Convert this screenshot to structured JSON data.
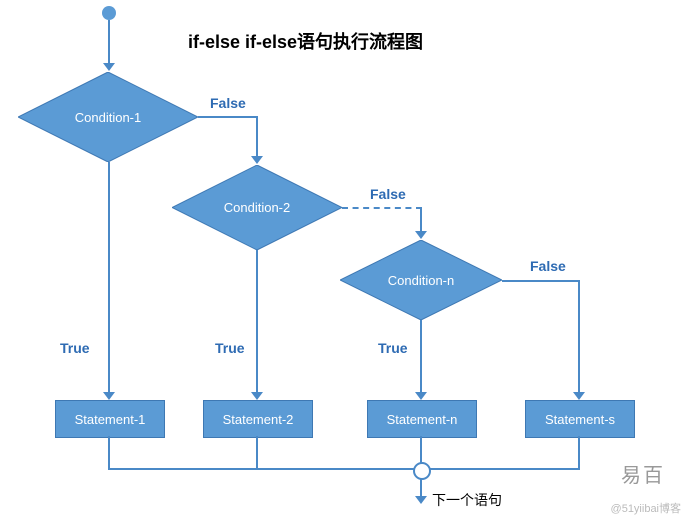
{
  "title": "if-else if-else语句执行流程图",
  "conditions": {
    "c1": "Condition-1",
    "c2": "Condition-2",
    "cn": "Condition-n"
  },
  "statements": {
    "s1": "Statement-1",
    "s2": "Statement-2",
    "sn": "Statement-n",
    "ss": "Statement-s"
  },
  "labels": {
    "true": "True",
    "false": "False"
  },
  "next": "下一个语句",
  "watermark_brand": "易百",
  "watermark_url": "@51yiibai博客"
}
